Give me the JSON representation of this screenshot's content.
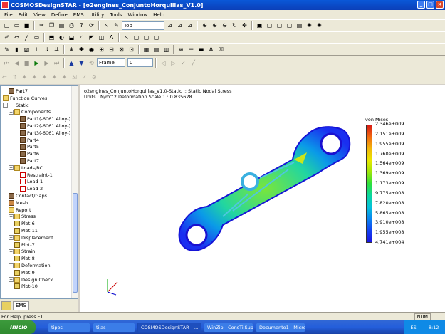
{
  "window": {
    "title": "COSMOSDesignSTAR - [o2engines_ConjuntoHorquillas_V1.0]"
  },
  "menu": [
    "File",
    "Edit",
    "View",
    "Define",
    "EMS",
    "Utility",
    "Tools",
    "Window",
    "Help"
  ],
  "toolbar": {
    "view_combo": "Top",
    "frame_label": "Frame",
    "frame_value": "0"
  },
  "tree": {
    "items": [
      {
        "label": "Part7",
        "icon": "part",
        "indent": 1
      },
      {
        "label": "Function Curves",
        "icon": "curve",
        "indent": 0
      },
      {
        "label": "Static",
        "icon": "static",
        "indent": 0
      },
      {
        "label": "Components",
        "icon": "fold",
        "indent": 1
      },
      {
        "label": "Part1(-6061 Alloy-)",
        "icon": "part",
        "indent": 3
      },
      {
        "label": "Part2(-6061 Alloy-)",
        "icon": "part",
        "indent": 3
      },
      {
        "label": "Part3(-6061 Alloy-)",
        "icon": "part",
        "indent": 3
      },
      {
        "label": "Part4",
        "icon": "part",
        "indent": 3
      },
      {
        "label": "Part5",
        "icon": "part",
        "indent": 3
      },
      {
        "label": "Part6",
        "icon": "part",
        "indent": 3
      },
      {
        "label": "Part7",
        "icon": "part",
        "indent": 3
      },
      {
        "label": "Loads/BC",
        "icon": "fold",
        "indent": 1
      },
      {
        "label": "Restraint-1",
        "icon": "load",
        "indent": 3
      },
      {
        "label": "Load-1",
        "icon": "load",
        "indent": 3
      },
      {
        "label": "Load-2",
        "icon": "load",
        "indent": 3
      },
      {
        "label": "Contact/Gaps",
        "icon": "part",
        "indent": 1
      },
      {
        "label": "Mesh",
        "icon": "mesh",
        "indent": 1
      },
      {
        "label": "Report",
        "icon": "fold",
        "indent": 1
      },
      {
        "label": "Stress",
        "icon": "fold",
        "indent": 1
      },
      {
        "label": "Plot-6",
        "icon": "plot",
        "indent": 2
      },
      {
        "label": "Plot-11",
        "icon": "plot",
        "indent": 2
      },
      {
        "label": "Displacement",
        "icon": "fold",
        "indent": 1
      },
      {
        "label": "Plot-7",
        "icon": "plot",
        "indent": 2
      },
      {
        "label": "Strain",
        "icon": "fold",
        "indent": 1
      },
      {
        "label": "Plot-8",
        "icon": "plot",
        "indent": 2
      },
      {
        "label": "Deformation",
        "icon": "fold",
        "indent": 1
      },
      {
        "label": "Plot-9",
        "icon": "plot",
        "indent": 2
      },
      {
        "label": "Design Check",
        "icon": "fold",
        "indent": 1
      },
      {
        "label": "Plot-10",
        "icon": "plot",
        "indent": 2
      }
    ],
    "tabs": [
      "",
      "EMS"
    ]
  },
  "viewport": {
    "title_line1": "o2engines_ConjuntoHorquillas_V1.0-Static :: Static Nodal Stress",
    "title_line2": "Units : N/m^2   Deformation Scale  1 : 0.835628",
    "legend_title": "von Mises",
    "legend_values": [
      "2.346e+009",
      "2.151e+009",
      "1.955e+009",
      "1.760e+009",
      "1.564e+009",
      "1.369e+009",
      "1.173e+009",
      "9.775e+008",
      "7.820e+008",
      "5.865e+008",
      "3.910e+008",
      "1.955e+008",
      "4.741e+004"
    ]
  },
  "status": {
    "text": "For Help, press F1",
    "num": "NUM"
  },
  "taskbar": {
    "start": "Inicio",
    "tasks": [
      {
        "label": "tipos",
        "active": false
      },
      {
        "label": "tijas",
        "active": false
      },
      {
        "label": "COSMOSDesignSTAR - ...",
        "active": true
      },
      {
        "label": "WinZip - ConsTijSupH...",
        "active": false
      },
      {
        "label": "Documento1 - Micros...",
        "active": false
      }
    ],
    "lang": "ES",
    "clock": "8:12"
  },
  "colors": {
    "accent": "#0b3fb8",
    "legend_max": "#d71a14",
    "legend_min": "#1b14e0"
  }
}
